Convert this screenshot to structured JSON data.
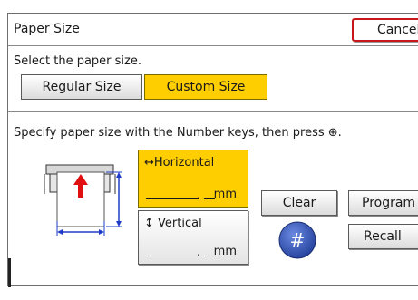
{
  "header": {
    "title": "Paper Size",
    "cancel_label": "Cancel"
  },
  "select": {
    "label": "Select the paper size.",
    "regular_label": "Regular Size",
    "custom_label": "Custom Size",
    "selected": "Custom Size"
  },
  "instruction": "Specify paper size with the Number keys, then press ⊕.",
  "horizontal": {
    "label": "↔Horizontal",
    "value": ".",
    "unit": "mm"
  },
  "vertical": {
    "label": "↕ Vertical",
    "value": ".",
    "unit": "mm"
  },
  "buttons": {
    "clear_label": "Clear",
    "program_label": "Program",
    "recall_label": "Recall",
    "hash_label": "#"
  },
  "colors": {
    "selected": "#ffce00",
    "cancel_border": "#c8161d",
    "arrow_blue": "#1e3cc8",
    "arrow_red": "#e01010",
    "hash_blue": "#2d4fb0"
  }
}
